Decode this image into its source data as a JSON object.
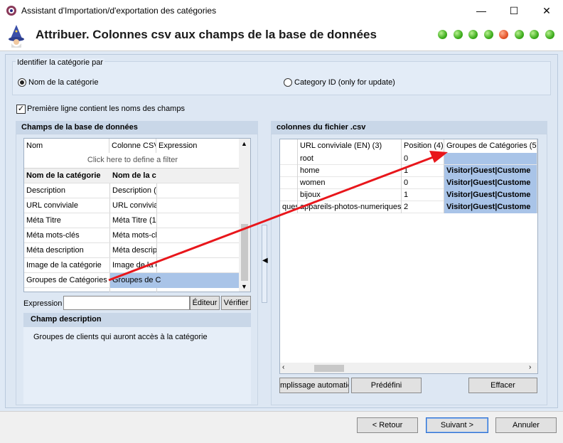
{
  "window": {
    "title": "Assistant d'Importation/d'exportation des catégories",
    "minimize": "—",
    "maximize": "☐",
    "close": "✕"
  },
  "header": {
    "title": "Attribuer. Colonnes csv aux champs de la base de données",
    "steps_total": 8,
    "current_step": 5
  },
  "identify": {
    "group_label": "Identifier la catégorie par",
    "option_name": "Nom de la catégorie",
    "option_id": "Category ID (only for update)",
    "selected": "option_name"
  },
  "first_row_checkbox": {
    "label": "Première ligne contient les noms des champs",
    "checked": true,
    "mark": "✓"
  },
  "db_fields": {
    "title": "Champs de la base de données",
    "columns": [
      "Nom",
      "Colonne CSV",
      "Expression"
    ],
    "filter_placeholder": "Click here to define a filter",
    "rows": [
      {
        "name": "Nom de la catégorie",
        "csv": "Nom de la c",
        "bold": true
      },
      {
        "name": "Description",
        "csv": "Description ("
      },
      {
        "name": "URL conviviale",
        "csv": "URL conviviali"
      },
      {
        "name": "Méta Titre",
        "csv": "Méta Titre (1"
      },
      {
        "name": "Méta mots-clés",
        "csv": "Méta mots-cl"
      },
      {
        "name": "Méta description",
        "csv": "Méta descript"
      },
      {
        "name": "Image de la catégorie",
        "csv": "Image de la c"
      },
      {
        "name": "Groupes de Catégories",
        "csv": "Groupes de C",
        "selected": true
      }
    ],
    "expression_label": "Expression",
    "editor_button": "Éditeur",
    "verify_button": "Vérifier",
    "desc_title": "Champ description",
    "desc_text": "Groupes de clients qui auront accès à la catégorie"
  },
  "csv_columns": {
    "title": "colonnes du fichier .csv",
    "columns": [
      "",
      "URL conviviale (EN) (3)",
      "Position (4)",
      "Groupes de Catégories (5)"
    ],
    "rows": [
      {
        "c0": "",
        "c1": "root",
        "c2": "0",
        "c3": ""
      },
      {
        "c0": "",
        "c1": "home",
        "c2": "1",
        "c3": "Visitor|Guest|Custome"
      },
      {
        "c0": "",
        "c1": "women",
        "c2": "0",
        "c3": "Visitor|Guest|Custome"
      },
      {
        "c0": "",
        "c1": "bijoux",
        "c2": "1",
        "c3": "Visitor|Guest|Custome"
      },
      {
        "c0": "ques",
        "c1": "appareils-photos-numeriques",
        "c2": "2",
        "c3": "Visitor|Guest|Custome"
      }
    ],
    "auto_fill_button": "mplissage automatic",
    "predefined_button": "Prédéfini",
    "clear_button": "Effacer"
  },
  "footer": {
    "back_button": "< Retour",
    "next_button": "Suivant >",
    "cancel_button": "Annuler"
  },
  "colors": {
    "accent": "#a9c4e8",
    "arrow": "#e8161b",
    "step_done": "#3fae1e",
    "step_current": "#e5552a"
  }
}
